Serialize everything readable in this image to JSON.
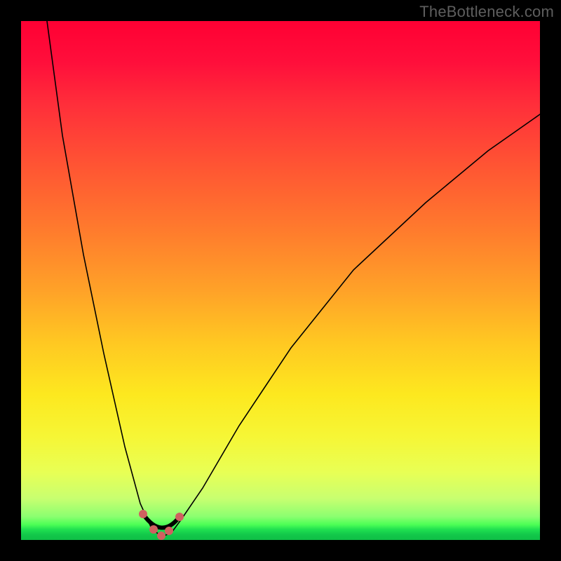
{
  "watermark": "TheBottleneck.com",
  "colors": {
    "page_bg": "#000000",
    "gradient_top": "#ff0033",
    "gradient_bottom": "#0fbf46",
    "curve": "#000000",
    "markers": "#d06060",
    "basin_stroke": "#d05555"
  },
  "chart_data": {
    "type": "line",
    "title": "",
    "xlabel": "",
    "ylabel": "",
    "xlim": [
      0,
      100
    ],
    "ylim": [
      0,
      100
    ],
    "grid": false,
    "legend": false,
    "notes": "V-shaped bottleneck curve. x≈27 is the minimum (near 0). Left branch rises steeply to ~100 at x≈5; right branch rises more gently to ~82 at x=100. Short salmon segment with dots marks the basin near x≈24–31.",
    "series": [
      {
        "name": "bottleneck_curve",
        "x": [
          5,
          8,
          12,
          16,
          20,
          23,
          25,
          27,
          29,
          31,
          35,
          42,
          52,
          64,
          78,
          90,
          100
        ],
        "y": [
          100,
          78,
          55,
          36,
          18,
          7,
          2.5,
          0.5,
          1.5,
          4,
          10,
          22,
          37,
          52,
          65,
          75,
          82
        ]
      },
      {
        "name": "basin_markers",
        "x": [
          23.5,
          25.5,
          27,
          28.5,
          30.5
        ],
        "y": [
          5,
          2,
          0.8,
          1.8,
          4.5
        ]
      }
    ]
  }
}
